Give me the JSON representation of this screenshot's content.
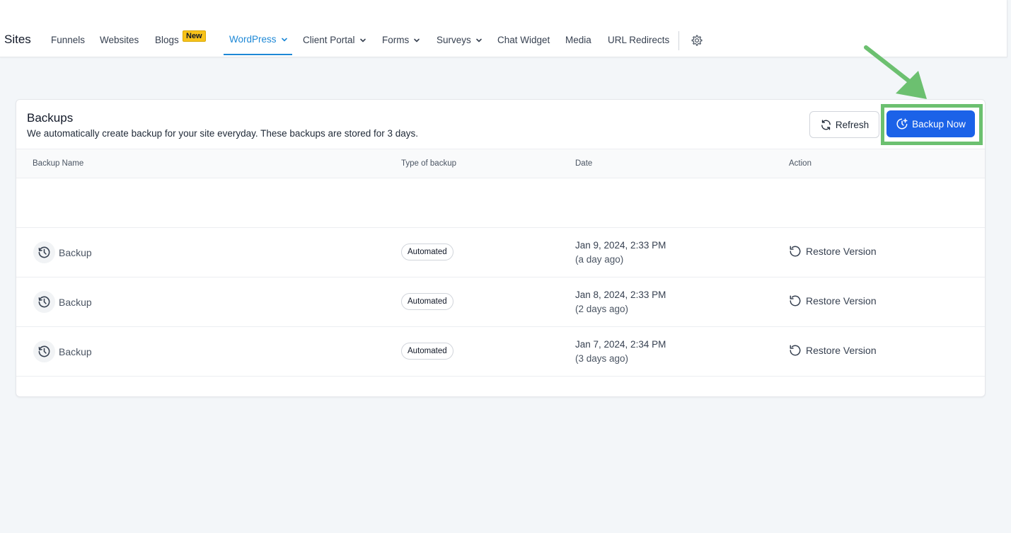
{
  "nav": {
    "brand": "Sites",
    "items": [
      {
        "label": "Funnels"
      },
      {
        "label": "Websites"
      },
      {
        "label": "Blogs"
      },
      {
        "label": "WordPress"
      },
      {
        "label": "Client Portal"
      },
      {
        "label": "Forms"
      },
      {
        "label": "Surveys"
      },
      {
        "label": "Chat Widget"
      },
      {
        "label": "Media"
      },
      {
        "label": "URL Redirects"
      }
    ],
    "new_badge": "New",
    "active_item": "WordPress"
  },
  "backups": {
    "title": "Backups",
    "subtitle": "We automatically create backup for your site everyday. These backups are stored for 3 days.",
    "refresh_label": "Refresh",
    "backup_now_label": "Backup Now",
    "columns": [
      "Backup Name",
      "Type of backup",
      "Date",
      "Action"
    ],
    "rows": [
      {
        "name": "Backup",
        "type": "Automated",
        "date": "Jan 9, 2024, 2:33 PM",
        "relative": "(a day ago)",
        "action": "Restore Version"
      },
      {
        "name": "Backup",
        "type": "Automated",
        "date": "Jan 8, 2024, 2:33 PM",
        "relative": "(2 days ago)",
        "action": "Restore Version"
      },
      {
        "name": "Backup",
        "type": "Automated",
        "date": "Jan 7, 2024, 2:34 PM",
        "relative": "(3 days ago)",
        "action": "Restore Version"
      }
    ]
  },
  "colors": {
    "primary": "#1b62e8",
    "active_tab": "#1e88d6",
    "highlight": "#6cc070",
    "badge": "#f7c21a"
  }
}
